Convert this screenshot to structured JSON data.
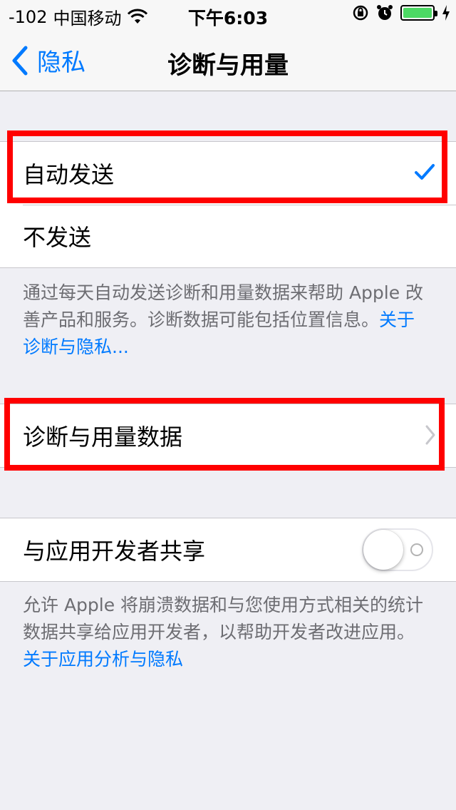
{
  "status_bar": {
    "signal": "-102",
    "carrier": "中国移动",
    "time": "下午6:03",
    "battery_level": 1.0,
    "battery_color": "#4cd964"
  },
  "nav": {
    "back_label": "隐私",
    "title": "诊断与用量"
  },
  "send_options": {
    "auto_send_label": "自动发送",
    "auto_send_selected": true,
    "dont_send_label": "不发送"
  },
  "send_footer": {
    "text": "通过每天自动发送诊断和用量数据来帮助 Apple 改善产品和服务。诊断数据可能包括位置信息。",
    "link_1": "关于",
    "link_2": "诊断与隐私..."
  },
  "usage_data": {
    "label": "诊断与用量数据"
  },
  "share": {
    "label": "与应用开发者共享",
    "enabled": false
  },
  "share_footer": {
    "text_line1": "允许 Apple 将崩溃数据和与您使用方式相关的统计",
    "text_line2": "数据共享给应用开发者，以帮助开发者改进应用。",
    "link": "关于应用分析与隐私"
  },
  "icons": {
    "wifi": "wifi-icon",
    "lock_rotation": "rotation-lock-icon",
    "alarm": "alarm-icon",
    "charging": "charging-bolt-icon",
    "back": "chevron-left-icon",
    "check": "checkmark-icon",
    "disclosure": "chevron-right-icon"
  },
  "colors": {
    "accent": "#007aff",
    "highlight": "#ff0000",
    "background": "#efeff4"
  }
}
